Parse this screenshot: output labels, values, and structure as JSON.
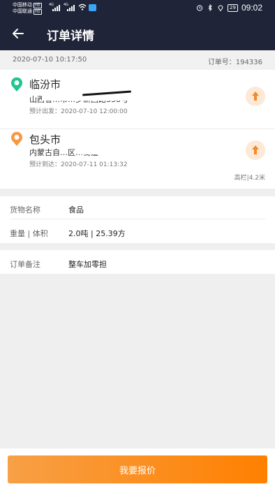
{
  "status_bar": {
    "carrier_1": "中国移动",
    "carrier_2": "中国联通",
    "hd_badge": "HD",
    "network_1": "4G",
    "network_2": "4G",
    "battery": "29",
    "time": "09:02",
    "icons": [
      "signal-icon",
      "wifi-icon",
      "app-notification-icon",
      "alarm-icon",
      "bluetooth-icon",
      "location-icon",
      "battery-icon"
    ]
  },
  "header": {
    "title": "订单详情",
    "back_icon": "back-arrow-icon"
  },
  "order": {
    "created_at": "2020-07-10 10:17:50",
    "order_no_label": "订单号：194336"
  },
  "route": {
    "origin": {
      "city": "临汾市",
      "address_visible": "山西省…市…乡新西路338号",
      "schedule": "预计出发：2020-07-10 12:00:00",
      "pin_color": "#21c48f"
    },
    "destination": {
      "city": "包头市",
      "address_visible": "内蒙古自…区…街道",
      "schedule": "预计到达：2020-07-11 01:13:32",
      "pin_color": "#f59a45"
    },
    "vehicle": "高栏|4.2米",
    "nav_icon": "navigate-arrow-icon",
    "accent": "#f28a26"
  },
  "goods": {
    "name_label": "货物名称",
    "name_value": "食品",
    "weight_label": "重量 | 体积",
    "weight_value": "2.0吨 | 25.39方"
  },
  "remark": {
    "label": "订单备注",
    "value": "整车加零担"
  },
  "action": {
    "quote_label": "我要报价",
    "button_color": "#ff8c1a"
  }
}
